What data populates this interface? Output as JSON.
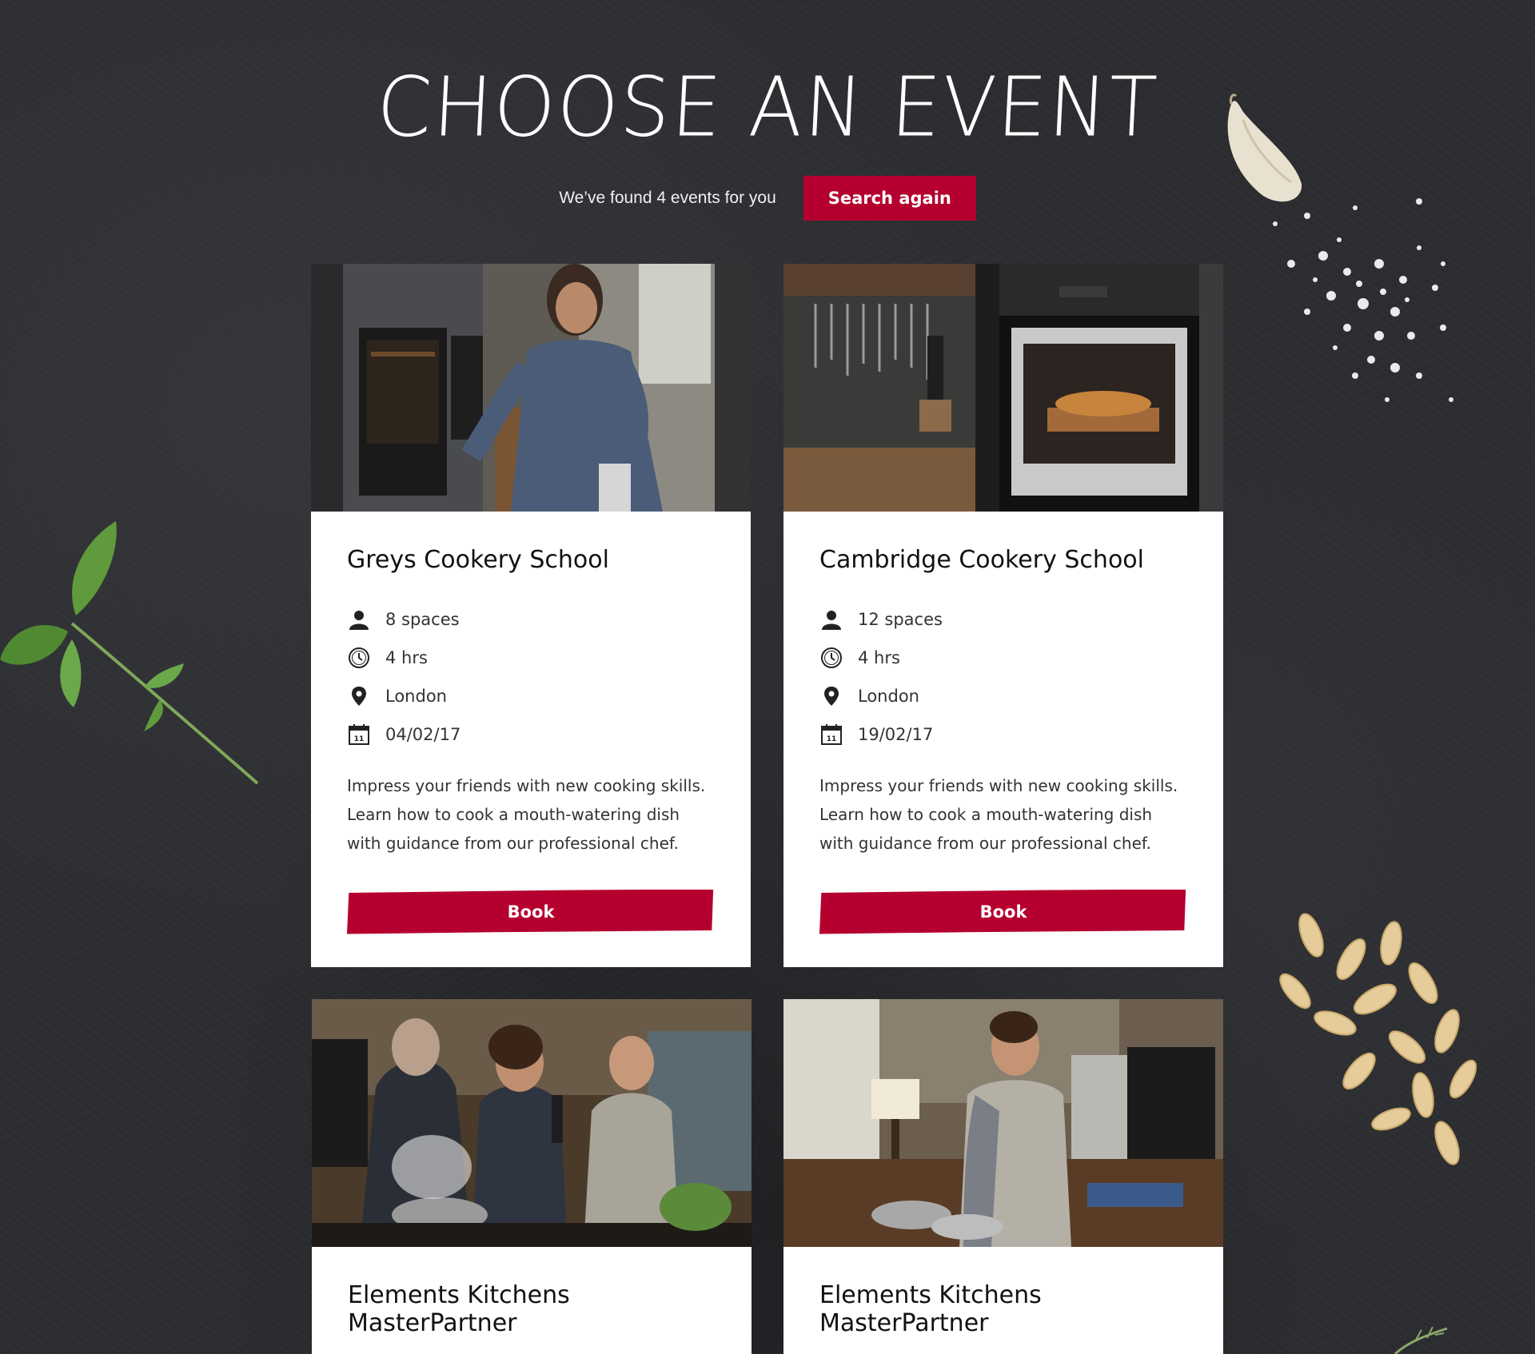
{
  "header": {
    "title": "CHOOSE AN EVENT",
    "results_text": "We’ve found 4 events for you",
    "search_again_label": "Search again"
  },
  "colors": {
    "accent": "#b5002f",
    "background": "#2c2d30",
    "card": "#ffffff"
  },
  "events": [
    {
      "name": "Greys Cookery School",
      "spaces": "8 spaces",
      "duration": "4 hrs",
      "location": "London",
      "date": "04/02/17",
      "description": "Impress your friends with new cooking skills. Learn how to cook a mouth-watering dish with guidance from our professional chef.",
      "book_label": "Book"
    },
    {
      "name": "Cambridge Cookery School",
      "spaces": "12 spaces",
      "duration": "4 hrs",
      "location": "London",
      "date": "19/02/17",
      "description": "Impress your friends with new cooking skills. Learn how to cook a mouth-watering dish with guidance from our professional chef.",
      "book_label": "Book"
    },
    {
      "name": "Elements Kitchens MasterPartner"
    },
    {
      "name": "Elements Kitchens MasterPartner"
    }
  ],
  "icons": {
    "spaces": "person-icon",
    "duration": "clock-icon",
    "location": "map-pin-icon",
    "date": "calendar-icon"
  }
}
